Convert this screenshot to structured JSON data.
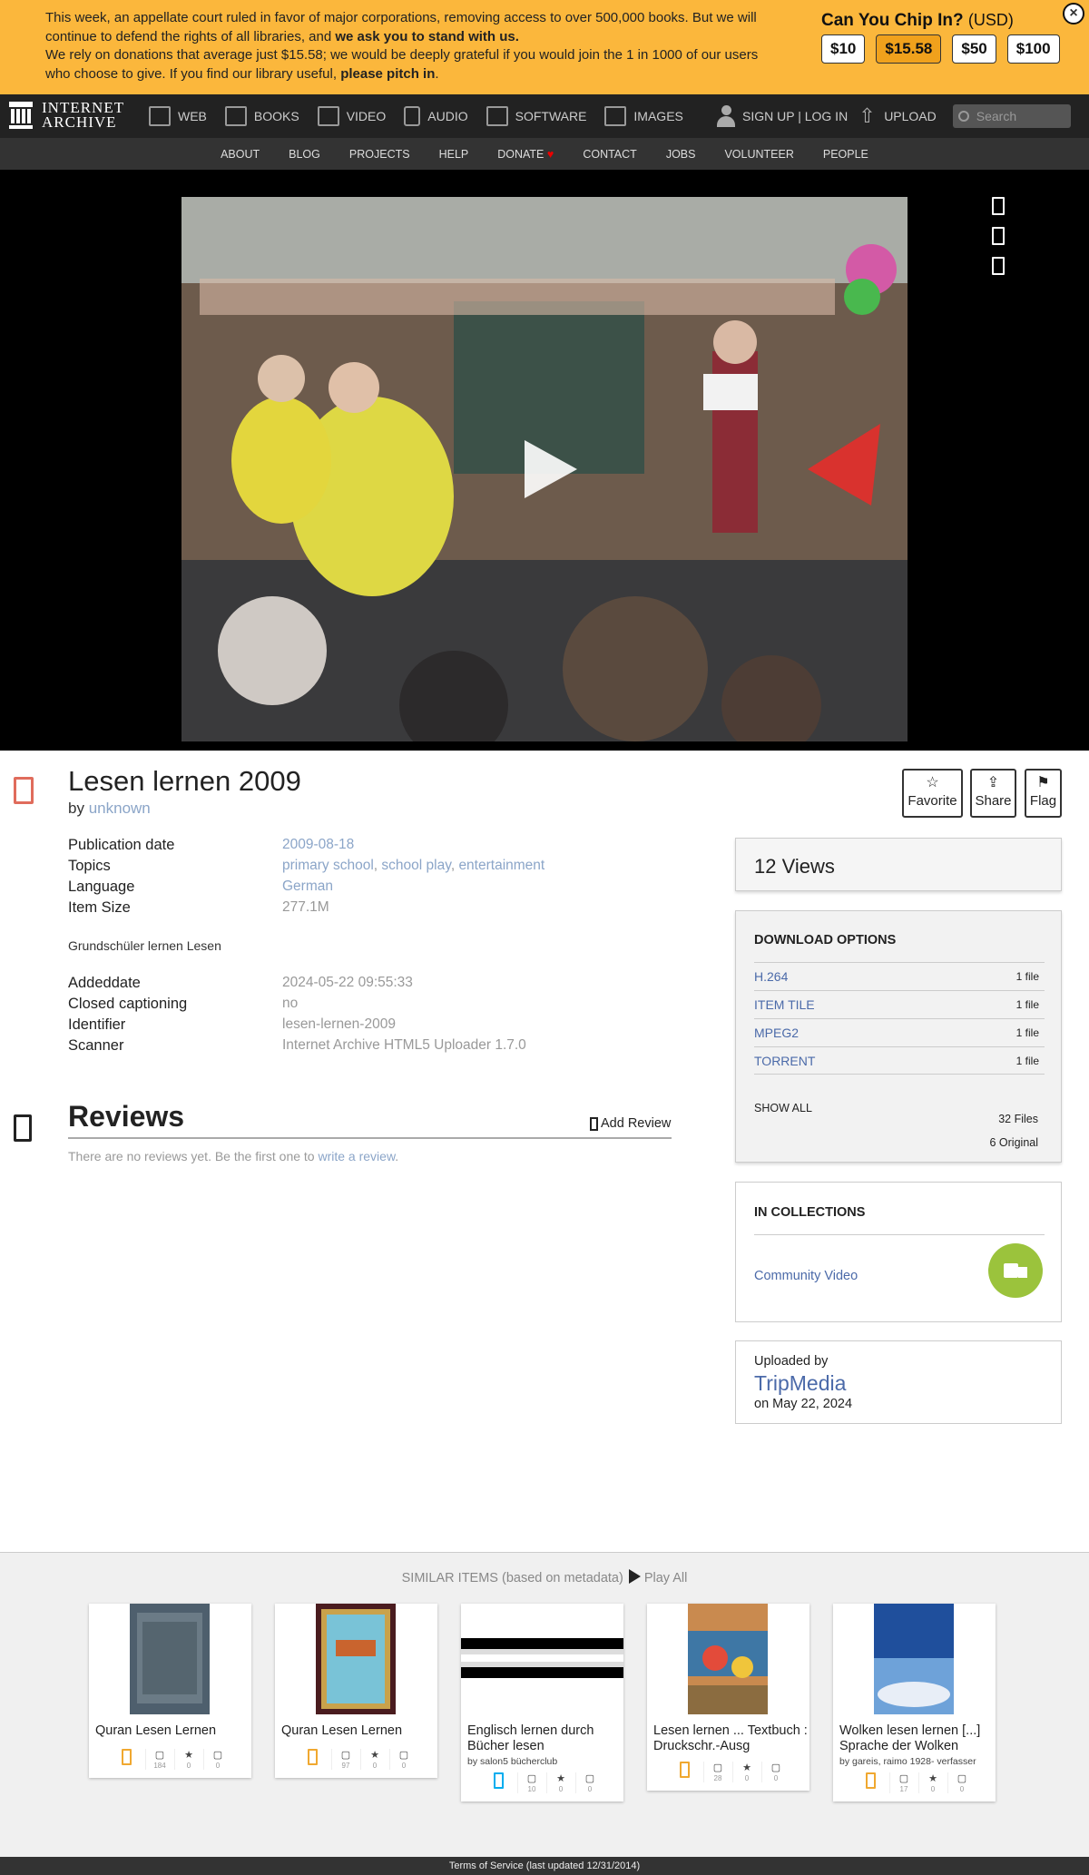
{
  "banner": {
    "line1a": "This week, an appellate court ruled in favor of major corporations, removing access to over 500,000 books. But we will continue to defend the rights of all libraries, and ",
    "line1b": "we ask you to stand with us.",
    "line2a": "We rely on donations that average just $15.58; we would be deeply grateful if you would join the 1 in 1000 of our users who choose to give. If you find our library useful, ",
    "line2b": "please pitch in",
    "line2c": ".",
    "chip_title": "Can You Chip In?",
    "chip_currency": "(USD)",
    "amounts": [
      "$10",
      "$15.58",
      "$50",
      "$100"
    ],
    "close": "×"
  },
  "logo": {
    "line1": "INTERNET",
    "line2": "ARCHIVE"
  },
  "nav": {
    "items": [
      "WEB",
      "BOOKS",
      "VIDEO",
      "AUDIO",
      "SOFTWARE",
      "IMAGES"
    ],
    "signup": "SIGN UP | LOG IN",
    "upload": "UPLOAD",
    "search_placeholder": "Search"
  },
  "subnav": [
    "ABOUT",
    "BLOG",
    "PROJECTS",
    "HELP",
    "DONATE",
    "CONTACT",
    "JOBS",
    "VOLUNTEER",
    "PEOPLE"
  ],
  "item": {
    "title": "Lesen lernen 2009",
    "by_label": "by",
    "creator": "unknown",
    "actions": [
      {
        "icon": "☆",
        "label": "Favorite"
      },
      {
        "icon": "⇪",
        "label": "Share"
      },
      {
        "icon": "⚑",
        "label": "Flag"
      }
    ],
    "meta": [
      {
        "key": "Publication date",
        "value": "2009-08-18"
      },
      {
        "key": "Topics",
        "value": "primary school, school play, entertainment"
      },
      {
        "key": "Language",
        "value": "German"
      },
      {
        "key": "Item Size",
        "value": "277.1M"
      }
    ],
    "topics": [
      "primary school",
      "school play",
      "entertainment"
    ],
    "description": "Grundschüler lernen Lesen",
    "meta2": [
      {
        "key": "Addeddate",
        "value": "2024-05-22 09:55:33"
      },
      {
        "key": "Closed captioning",
        "value": "no"
      },
      {
        "key": "Identifier",
        "value": "lesen-lernen-2009"
      },
      {
        "key": "Scanner",
        "value": "Internet Archive HTML5 Uploader 1.7.0"
      }
    ]
  },
  "reviews": {
    "title": "Reviews",
    "add": "Add Review",
    "empty_text": "There are no reviews yet. Be the first one to ",
    "empty_link": "write a review",
    "empty_end": "."
  },
  "sidebar": {
    "views": "12 Views",
    "download_head": "DOWNLOAD OPTIONS",
    "downloads": [
      {
        "format": "H.264",
        "count": "1 file"
      },
      {
        "format": "ITEM TILE",
        "count": "1 file"
      },
      {
        "format": "MPEG2",
        "count": "1 file"
      },
      {
        "format": "TORRENT",
        "count": "1 file"
      }
    ],
    "show_all": "SHOW ALL",
    "total_files": "32 Files",
    "original_files": "6 Original",
    "collections_head": "IN COLLECTIONS",
    "collection": "Community Video",
    "uploaded_by_label": "Uploaded by",
    "uploader": "TripMedia",
    "uploaded_on": "on May 22, 2024"
  },
  "similar": {
    "head": "SIMILAR ITEMS (based on metadata)",
    "play_all": "Play All",
    "items": [
      {
        "title": "Quran Lesen Lernen",
        "by": "",
        "views": "184",
        "favs": "0",
        "reviews": "0",
        "type": "texts"
      },
      {
        "title": "Quran Lesen Lernen",
        "by": "",
        "views": "97",
        "favs": "0",
        "reviews": "0",
        "type": "texts"
      },
      {
        "title": "Englisch lernen durch Bücher lesen",
        "by": "by salon5 bücherclub",
        "views": "10",
        "favs": "0",
        "reviews": "0",
        "type": "audio"
      },
      {
        "title": "Lesen lernen ... Textbuch : Druckschr.-Ausg",
        "by": "",
        "views": "28",
        "favs": "0",
        "reviews": "0",
        "type": "texts"
      },
      {
        "title": "Wolken lesen lernen [...] Sprache der Wolken",
        "by": "by gareis, raimo 1928- verfasser",
        "views": "17",
        "favs": "0",
        "reviews": "0",
        "type": "texts"
      }
    ]
  },
  "footer": "Terms of Service (last updated 12/31/2014)",
  "colors": {
    "accent": "#fbb73c",
    "link": "#4b6aa9",
    "collection": "#9bc33c"
  }
}
